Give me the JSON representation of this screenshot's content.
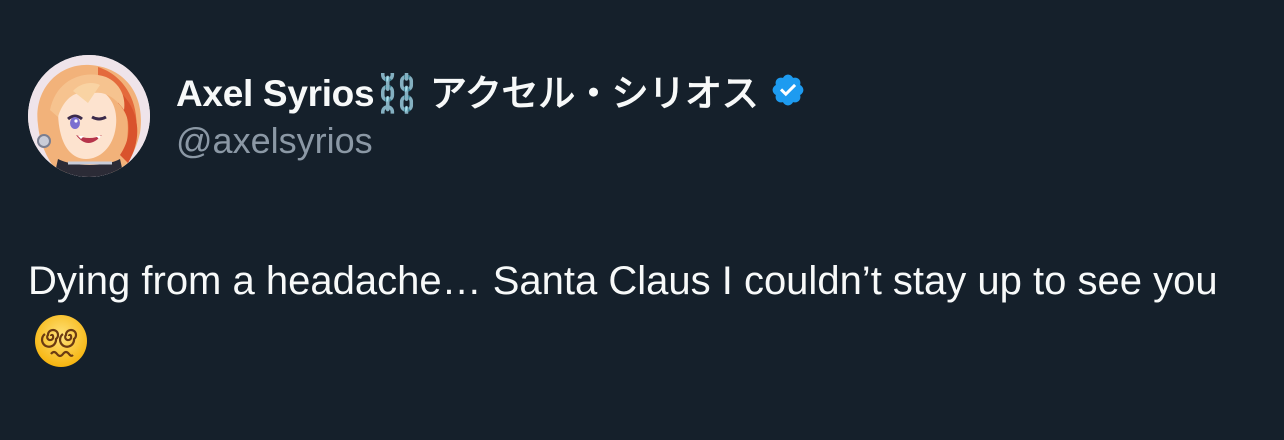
{
  "tweet": {
    "author": {
      "display_name": "Axel Syrios⛓️ アクセル・シリオス",
      "handle": "@axelsyrios",
      "verified": true,
      "avatar_icon": "anime-character-avatar",
      "verified_icon": "verified-badge-icon",
      "verified_color": "#1d9bf0"
    },
    "text": "Dying from a headache… Santa Claus I couldn’t stay up to see you",
    "emoji": "face-with-spiral-eyes-emoji"
  },
  "colors": {
    "background": "#15202b",
    "text_primary": "#f7f9f9",
    "text_secondary": "#8b98a5"
  }
}
